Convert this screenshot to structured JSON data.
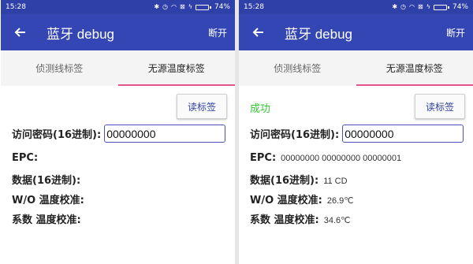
{
  "left": {
    "status": {
      "time": "15:28",
      "battery": "74%",
      "battery_level": 0.74
    },
    "appbar": {
      "title": "蓝牙 debug",
      "action": "断开"
    },
    "tabs": [
      {
        "label": "侦测线标签",
        "active": false
      },
      {
        "label": "无源温度标签",
        "active": true
      }
    ],
    "read_button": "读标签",
    "success_text": "",
    "password": {
      "label": "访问密码(16进制):",
      "value": "00000000"
    },
    "fields": [
      {
        "label": "EPC:",
        "value": ""
      },
      {
        "label": "数据(16进制):",
        "value": ""
      },
      {
        "label": "W/O 温度校准:",
        "value": ""
      },
      {
        "label": "系数 温度校准:",
        "value": ""
      }
    ]
  },
  "right": {
    "status": {
      "time": "15:28",
      "battery": "74%",
      "battery_level": 0.74
    },
    "appbar": {
      "title": "蓝牙 debug",
      "action": "断开"
    },
    "tabs": [
      {
        "label": "侦测线标签",
        "active": false
      },
      {
        "label": "无源温度标签",
        "active": true
      }
    ],
    "read_button": "读标签",
    "success_text": "成功",
    "password": {
      "label": "访问密码(16进制):",
      "value": "00000000"
    },
    "fields": [
      {
        "label": "EPC:",
        "value": "00000000 00000000 00000001"
      },
      {
        "label": "数据(16进制):",
        "value": "11 CD"
      },
      {
        "label": "W/O 温度校准:",
        "value": "26.9℃"
      },
      {
        "label": "系数 温度校准:",
        "value": "34.6℃"
      }
    ]
  },
  "colors": {
    "statusbar": "#2f40a8",
    "appbar": "#3446b4",
    "tab_indicator": "#e4548a",
    "success": "#2ecb2e",
    "input_border": "#4a52b8"
  },
  "icons": [
    "back-arrow-icon",
    "bluetooth-icon",
    "alarm-icon",
    "wifi-icon",
    "close-box-icon",
    "charging-icon",
    "battery-icon"
  ]
}
